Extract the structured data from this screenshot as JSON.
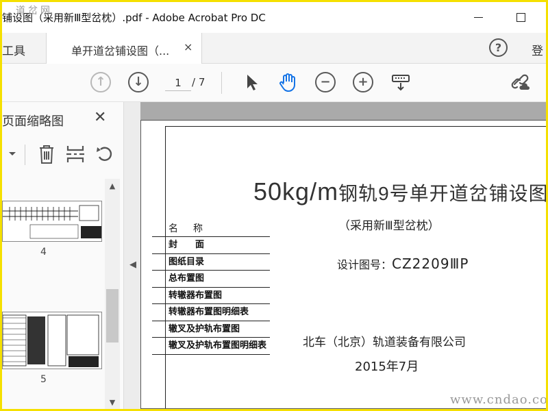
{
  "window": {
    "title": "铺设图（采用新Ⅲ型岔枕）.pdf - Adobe Acrobat Pro DC",
    "watermark_top": "道岔网"
  },
  "tabs": {
    "tools_label": "工具",
    "active_tab": "单开道岔铺设图（...",
    "close_glyph": "×",
    "help_glyph": "?",
    "login_label": "登"
  },
  "toolbar": {
    "page_current": "1",
    "page_total": "/ 7",
    "icons": [
      "prev-page-icon",
      "next-page-icon",
      "select-arrow-icon",
      "hand-tool-icon",
      "zoom-out-icon",
      "zoom-in-icon",
      "keyboard-icon",
      "share-link-icon"
    ]
  },
  "left_panel": {
    "title": "页面缩略图",
    "close_glyph": "✕",
    "thumbnails": [
      {
        "page": "4"
      },
      {
        "page": "5"
      }
    ]
  },
  "document": {
    "title_latin": "50kg/m",
    "title_cn": "钢轨9号单开道岔铺设图",
    "subtitle": "（采用新Ⅲ型岔枕）",
    "drawing_label": "设计图号：",
    "drawing_code": "CZ2209ⅢP",
    "list_header": "名称",
    "list_items": [
      "封　　面",
      "图纸目录",
      "总布置图",
      "转辙器布置图",
      "转辙器布置图明细表",
      "辙叉及护轨布置图",
      "辙叉及护轨布置图明细表"
    ],
    "company": "北车（北京）轨道装备有限公司",
    "date": "2015年7月"
  },
  "watermark_bottom": "www.cndao.com"
}
